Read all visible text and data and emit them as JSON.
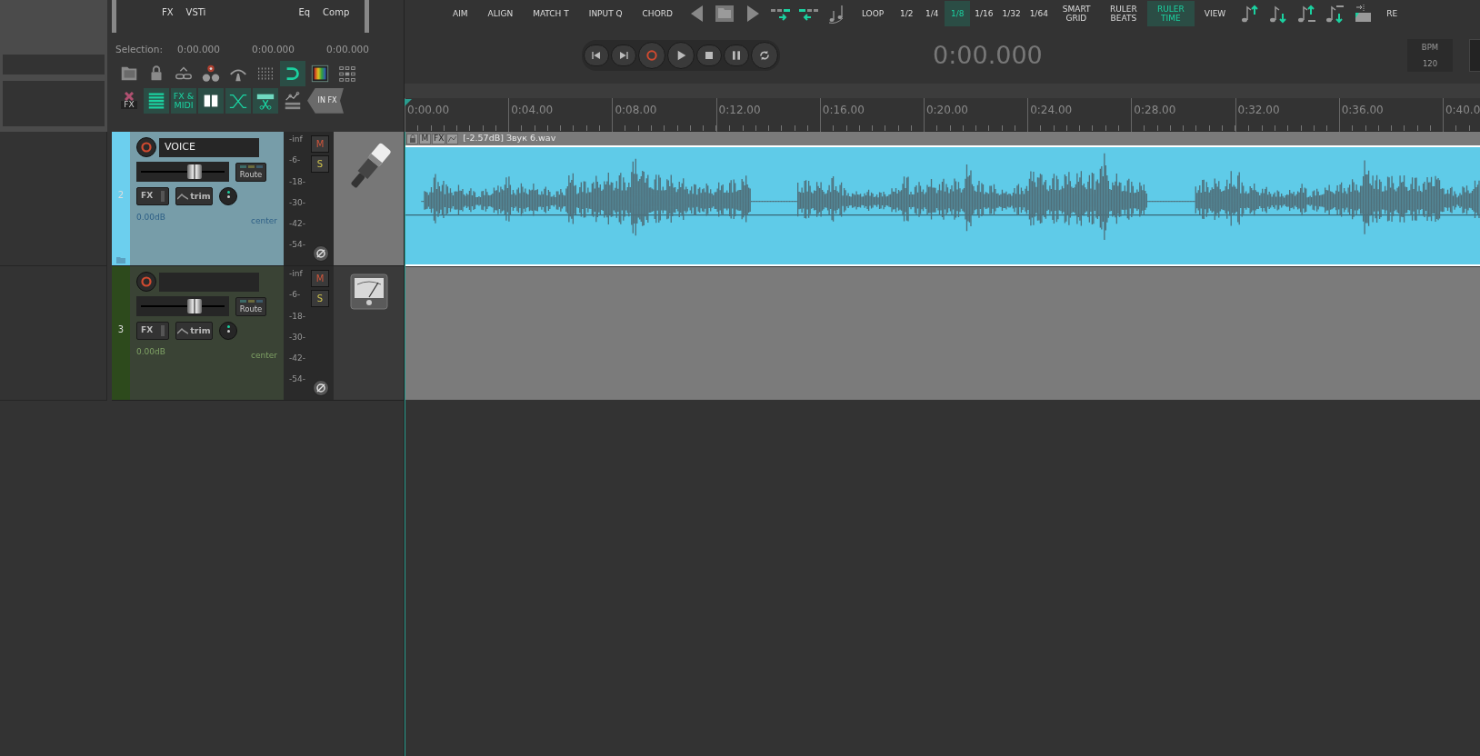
{
  "fx_bar": {
    "items": [
      "FX",
      "VSTi",
      "Eq",
      "Comp"
    ]
  },
  "selection": {
    "label": "Selection:",
    "values": [
      "0:00.000",
      "0:00.000",
      "0:00.000"
    ]
  },
  "edit_tools": [
    {
      "buttons": [
        {
          "kind": "folder",
          "on": false
        },
        {
          "kind": "lock",
          "on": false
        },
        {
          "kind": "link",
          "on": false
        },
        {
          "kind": "reels",
          "on": false
        },
        {
          "kind": "arch",
          "on": false
        },
        {
          "kind": "gridlines",
          "on": false
        },
        {
          "kind": "magnet",
          "on": true
        },
        {
          "kind": "spectrum",
          "on": false
        },
        {
          "kind": "squares",
          "on": false
        }
      ]
    },
    {
      "buttons": [
        {
          "kind": "cross",
          "label": "FX",
          "on": false
        },
        {
          "kind": "lines",
          "on": true
        },
        {
          "kind": "text",
          "label": "FX & MIDI",
          "on": true
        },
        {
          "kind": "panes",
          "on": true
        },
        {
          "kind": "crossfade",
          "on": true
        },
        {
          "kind": "scissors",
          "on": true
        },
        {
          "kind": "envelope",
          "on": false
        },
        {
          "kind": "tag",
          "label": "IN FX",
          "on": false
        }
      ]
    }
  ],
  "toolbar": [
    {
      "kind": "text",
      "label": "AIM",
      "selected": false
    },
    {
      "kind": "text",
      "label": "ALIGN",
      "selected": false
    },
    {
      "kind": "text",
      "label": "MATCH T",
      "selected": false
    },
    {
      "kind": "text",
      "label": "INPUT Q",
      "selected": false
    },
    {
      "kind": "text",
      "label": "CHORD",
      "selected": false
    },
    {
      "kind": "back"
    },
    {
      "kind": "project"
    },
    {
      "kind": "forward"
    },
    {
      "kind": "shiftright"
    },
    {
      "kind": "shiftleft"
    },
    {
      "kind": "notes"
    },
    {
      "kind": "text",
      "label": "LOOP",
      "selected": false
    },
    {
      "kind": "grid",
      "label": "1/2",
      "selected": false
    },
    {
      "kind": "grid",
      "label": "1/4",
      "selected": false
    },
    {
      "kind": "grid",
      "label": "1/8",
      "selected": true
    },
    {
      "kind": "grid",
      "label": "1/16",
      "selected": false
    },
    {
      "kind": "grid",
      "label": "1/32",
      "selected": false
    },
    {
      "kind": "grid",
      "label": "1/64",
      "selected": false
    },
    {
      "kind": "text",
      "label": "SMART GRID",
      "selected": false
    },
    {
      "kind": "text",
      "label": "RULER BEATS",
      "selected": false
    },
    {
      "kind": "text",
      "label": "RULER TIME",
      "selected": true
    },
    {
      "kind": "text",
      "label": "VIEW",
      "selected": false
    },
    {
      "kind": "noteup"
    },
    {
      "kind": "notedown"
    },
    {
      "kind": "noteupoct"
    },
    {
      "kind": "notedownoct"
    },
    {
      "kind": "insert"
    },
    {
      "kind": "text",
      "label": "RE",
      "selected": false
    }
  ],
  "transport": {
    "buttons": [
      {
        "kind": "start"
      },
      {
        "kind": "end"
      },
      {
        "kind": "record"
      },
      {
        "kind": "play"
      },
      {
        "kind": "stop"
      },
      {
        "kind": "pause"
      },
      {
        "kind": "repeat"
      }
    ],
    "time": "0:00.000",
    "tempo": {
      "label": "BPM",
      "value": "120"
    }
  },
  "ruler": [
    "0:00.00",
    "0:04.00",
    "0:08.00",
    "0:12.00",
    "0:16.00",
    "0:20.00",
    "0:24.00",
    "0:28.00",
    "0:32.00",
    "0:36.00",
    "0:40.0"
  ],
  "tracks": [
    {
      "number": "2",
      "name": "VOICE",
      "color": "#6ccfee",
      "selected": true,
      "folder": true,
      "fx": "FX",
      "trim": "trim",
      "route": "Route",
      "volume": "0.00dB",
      "pan": "center",
      "fader": {
        "level": 0.64
      },
      "meter_labels": [
        "-inf",
        "-6-",
        "-18-",
        "-30-",
        "-42-",
        "-54-"
      ],
      "mute": "M",
      "solo": "S",
      "item": {
        "buttons": [
          "M",
          "FX"
        ],
        "label": "[-2.57dB] Звук 6.wav"
      }
    },
    {
      "number": "3",
      "color": "#2d4a1c",
      "selected": false,
      "folder": false,
      "fx": "FX",
      "trim": "trim",
      "route": "Route",
      "volume": "0.00dB",
      "pan": "center",
      "fader": {
        "level": 0.64
      },
      "meter_labels": [
        "-inf",
        "-6-",
        "-18-",
        "-30-",
        "-42-",
        "-54-"
      ],
      "mute": "M",
      "solo": "S"
    }
  ]
}
